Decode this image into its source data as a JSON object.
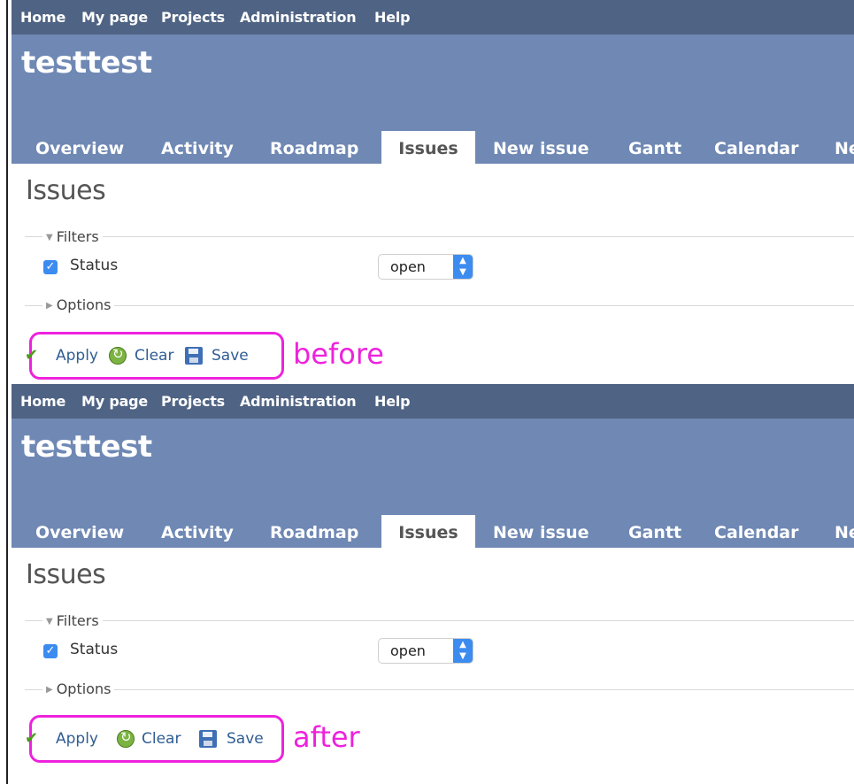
{
  "topmenu": [
    "Home",
    "My page",
    "Projects",
    "Administration",
    "Help"
  ],
  "project_title": "testtest",
  "tabs": [
    "Overview",
    "Activity",
    "Roadmap",
    "Issues",
    "New issue",
    "Gantt",
    "Calendar",
    "Ne"
  ],
  "page_title": "Issues",
  "filters": {
    "legend": "Filters",
    "status_label": "Status",
    "status_checked": true,
    "status_value": "open"
  },
  "options_legend": "Options",
  "actions": [
    "Apply",
    "Clear",
    "Save"
  ],
  "annotations": [
    "before",
    "after"
  ],
  "colors": {
    "topmenu_bg": "#4f6384",
    "header_bg": "#6f88b4",
    "link": "#2f5d93",
    "highlight": "#ee22dd"
  }
}
